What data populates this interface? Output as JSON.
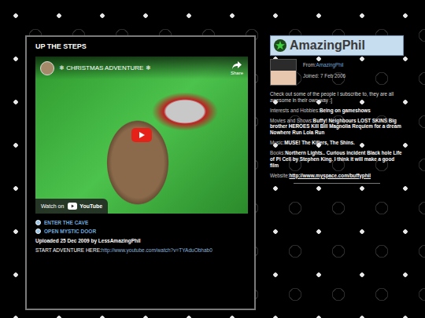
{
  "video_box": {
    "title": "UP THE STEPS",
    "player": {
      "video_title": "❄ CHRISTMAS ADVENTURE ❄",
      "share": "Share",
      "watch_on": "Watch on",
      "youtube": "YouTube"
    },
    "links": [
      "ENTER THE CAVE",
      "OPEN MYSTIC DOOR"
    ],
    "uploaded": "Uploaded 25 Dec 2009 by LessAmazingPhil",
    "start": {
      "label": "START ADVENTURE HERE:",
      "url": "http://www.youtube.com/watch?v=TYAduObhab0"
    }
  },
  "profile": {
    "name": "AmazingPhil",
    "from_label": "From:",
    "from": "AmazingPhil",
    "joined": "Joined: 7 Feb 2006",
    "bio": "Check out some of the people I subscribe to, they are all awesome in their own way :]",
    "fields": [
      {
        "label": "Interests and Hobbies:",
        "value": "Being on gameshows",
        "kind": "text"
      },
      {
        "label": "Movies and Shows:",
        "value": "Buffy! Neighbours LOST SKINS Big brother HEROES Kill Bill Magnolia Requiem for a dream Nowhere Run Lola Run",
        "kind": "text"
      },
      {
        "label": "Music:",
        "value": "MUSE! The Killers, The Shins.",
        "kind": "text"
      },
      {
        "label": "Books:",
        "value": "Northern Lights.. Curious incident Black hole Life of Pi Cell by Stephen King. I think it will make a good film",
        "kind": "text"
      },
      {
        "label": "Website:",
        "value": "http://www.myspace.com/buffyphil",
        "kind": "link"
      }
    ]
  }
}
